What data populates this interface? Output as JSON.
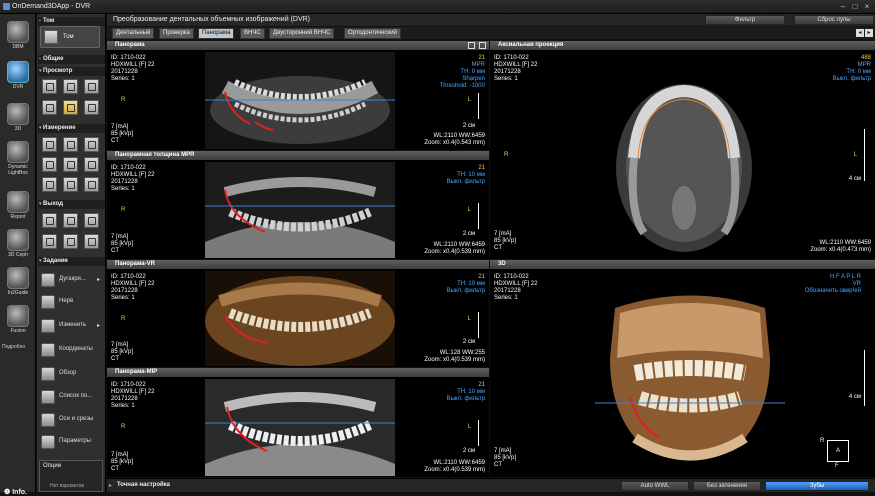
{
  "app": {
    "title": "OnDemand3DApp - DVR"
  },
  "left_nav": [
    {
      "label": "DBM"
    },
    {
      "label": "DVR"
    },
    {
      "label": "3D"
    },
    {
      "label": "Dynamic LightBox"
    },
    {
      "label": "Report"
    },
    {
      "label": "3D Ceph"
    },
    {
      "label": "In2Guide"
    },
    {
      "label": "Fusion"
    },
    {
      "label": "Подробно"
    }
  ],
  "info_label": "Info.",
  "tools": {
    "tom_label": "Том",
    "header": "Общие",
    "sections": {
      "view": "Просмотр",
      "measure": "Измерение",
      "output": "Выход",
      "task": "Задание"
    },
    "task_items": [
      {
        "label": "Дугакри..."
      },
      {
        "label": "Нерв"
      },
      {
        "label": "Изменить"
      },
      {
        "label": "Координаты"
      },
      {
        "label": "Обзор"
      },
      {
        "label": "Список по..."
      },
      {
        "label": "Оси и срезы"
      },
      {
        "label": "Параметры"
      }
    ],
    "options_title": "Опции",
    "options_value": "Нет вариантов"
  },
  "top": {
    "title": "Преобразование дентальных объемных изображений (DVR)",
    "filter_button": "Фильтр",
    "reset_button": "Сброс лупы"
  },
  "tabs": [
    "Дентальный",
    "Проверка",
    "Панорама",
    "ВНЧС",
    "Двусторонний ВНЧС",
    "Ортодонтический"
  ],
  "panels": {
    "p1": {
      "title": "Панорама",
      "id": "ID: 1710-022",
      "name": "HDXWILL [F] 22",
      "date": "20171228",
      "series": "Series: 1",
      "ma": "7 [mA]",
      "kvp": "85 [kVp]",
      "mod": "CT",
      "r_num": "21",
      "r_mode": "MPR",
      "r_th": "TH: 0 мм",
      "r_filter": "Sharpen",
      "r_thr": "Threshold: -1000",
      "wl": "WL:2110 WW:6459",
      "zoom": "Zoom: x0.4(0.543 mm)",
      "scale": "2 см",
      "side": "R",
      "side2": "L"
    },
    "p2": {
      "title": "Панорамная толщина MPR",
      "id": "ID: 1710-022",
      "name": "HDXWILL [F] 22",
      "date": "20171228",
      "series": "Series: 1",
      "ma": "7 [mA]",
      "kvp": "85 [kVp]",
      "mod": "CT",
      "r_num": "21",
      "r_th": "TH: 10 мм",
      "r_filter": "Выкл. фильтр",
      "wl": "WL:2110 WW:6459",
      "zoom": "Zoom: x0.4(0.539 mm)",
      "scale": "2 см",
      "side": "R",
      "side2": "L"
    },
    "p3": {
      "title": "Панорама-VR",
      "id": "ID: 1710-022",
      "name": "HDXWILL [F] 22",
      "date": "20171228",
      "series": "Series: 1",
      "ma": "7 [mA]",
      "kvp": "85 [kVp]",
      "mod": "CT",
      "r_num": "21",
      "r_th": "TH: 10 мм",
      "r_filter": "Выкл. фильтр",
      "wl": "WL:128 WW:255",
      "zoom": "Zoom: x0.4(0.539 mm)",
      "scale": "2 см",
      "side": "R",
      "side2": "L"
    },
    "p4": {
      "title": "Панорама-MIP",
      "id": "ID: 1710-022",
      "name": "HDXWILL [F] 22",
      "date": "20171228",
      "series": "Series: 1",
      "ma": "7 [mA]",
      "kvp": "85 [kVp]",
      "mod": "CT",
      "r_num": "21",
      "r_th": "TH: 10 мм",
      "r_filter": "Выкл. фильтр",
      "wl": "WL:2110 WW:6459",
      "zoom": "Zoom: x0.4(0.539 mm)",
      "scale": "2 см",
      "side": "R",
      "side2": "L"
    },
    "p5": {
      "title": "Аксиальная проекция",
      "id": "ID: 1710-022",
      "name": "HDXWILL [F] 22",
      "date": "20171228",
      "series": "Series: 1",
      "ma": "7 [mA]",
      "kvp": "85 [kVp]",
      "mod": "CT",
      "r_num": "488",
      "r_mode": "MPR",
      "r_th": "TH: 0 мм",
      "r_filter": "Выкл. фильтр",
      "wl": "WL:2110 WW:6459",
      "zoom": "Zoom: x0.4(0.473 mm)",
      "scale": "4 см",
      "side": "R",
      "side2": "L"
    },
    "p6": {
      "title": "3D",
      "id": "ID: 1710-022",
      "name": "HDXWILL [F] 22",
      "date": "20171228",
      "series": "Series: 1",
      "ma": "7 [mA]",
      "kvp": "85 [kVp]",
      "mod": "CT",
      "r_orient": "H F A P L R",
      "r_mode": "VR",
      "r_filter": "Обозначить овер!ей",
      "scale": "4 см",
      "cube_r": "R",
      "cube_a": "A",
      "cube_f": "F"
    }
  },
  "bottom": {
    "title": "Точная настройка",
    "auto_wwl": "Auto WWL",
    "no_shade": "Без затенения",
    "teeth": "Зубы"
  }
}
